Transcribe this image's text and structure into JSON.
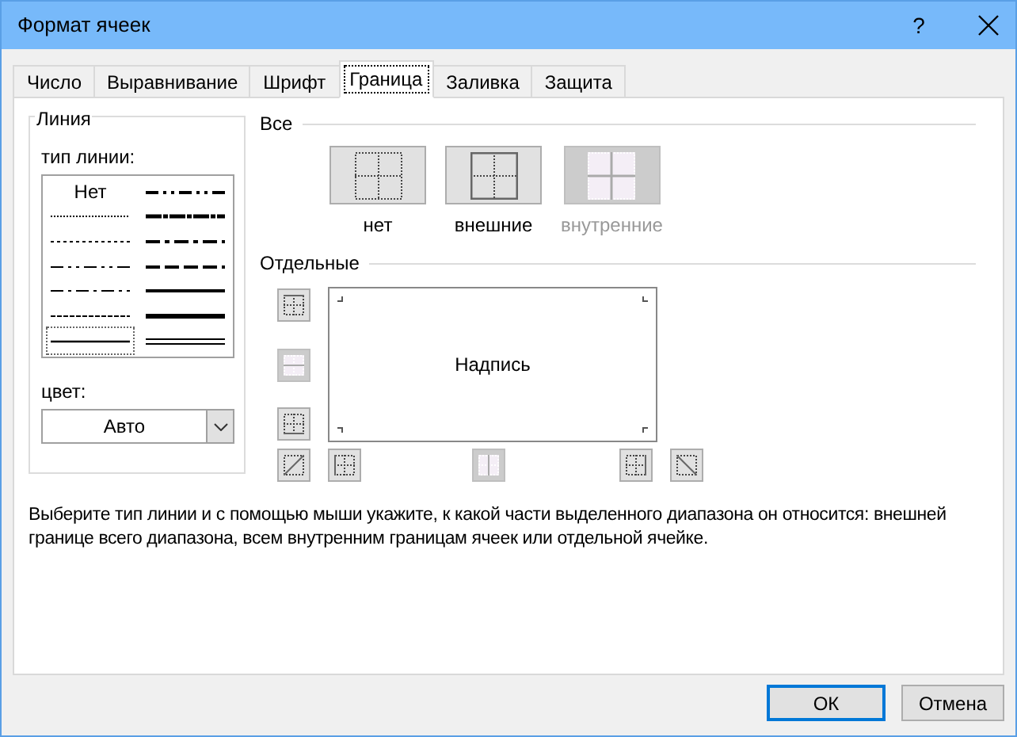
{
  "window": {
    "title": "Формат ячеек",
    "help": "?"
  },
  "tabs": [
    {
      "label": "Число",
      "selected": false
    },
    {
      "label": "Выравнивание",
      "selected": false
    },
    {
      "label": "Шрифт",
      "selected": false
    },
    {
      "label": "Граница",
      "selected": true
    },
    {
      "label": "Заливка",
      "selected": false
    },
    {
      "label": "Защита",
      "selected": false
    }
  ],
  "line_group": {
    "title": "Линия",
    "type_label": "тип линии:",
    "color_label": "цвет:",
    "color_value": "Авто"
  },
  "line_styles": [
    {
      "kind": "none",
      "label": "Нет",
      "selected": false
    },
    {
      "kind": "hair",
      "selected": false
    },
    {
      "kind": "dotted",
      "selected": false
    },
    {
      "kind": "dashdotdot",
      "selected": false
    },
    {
      "kind": "dashdot",
      "selected": false
    },
    {
      "kind": "dashed",
      "selected": false
    },
    {
      "kind": "thin",
      "selected": true
    },
    {
      "kind": "medium-dashdotdot",
      "selected": false
    },
    {
      "kind": "slant-dashdot",
      "selected": false
    },
    {
      "kind": "medium-dashdot",
      "selected": false
    },
    {
      "kind": "medium-dashed",
      "selected": false
    },
    {
      "kind": "medium",
      "selected": false
    },
    {
      "kind": "thick",
      "selected": false
    },
    {
      "kind": "double",
      "selected": false
    }
  ],
  "presets_title": "Все",
  "presets": [
    {
      "kind": "none",
      "label": "нет",
      "disabled": false
    },
    {
      "kind": "outline",
      "label": "внешние",
      "disabled": false
    },
    {
      "kind": "inside",
      "label": "внутренние",
      "disabled": true
    }
  ],
  "borders_title": "Отдельные",
  "preview_text": "Надпись",
  "side_buttons": [
    {
      "kind": "top",
      "disabled": false
    },
    {
      "kind": "inner-horizontal",
      "disabled": true
    },
    {
      "kind": "bottom",
      "disabled": false
    }
  ],
  "bottom_buttons": [
    {
      "kind": "diag-up",
      "disabled": false
    },
    {
      "kind": "left",
      "disabled": false
    },
    {
      "kind": "inner-vertical",
      "disabled": true
    },
    {
      "kind": "right",
      "disabled": false
    },
    {
      "kind": "diag-down",
      "disabled": false
    }
  ],
  "description": "Выберите тип линии и с помощью мыши укажите, к какой части выделенного диапазона он относится: внешней границе всего диапазона, всем внутренним границам ячеек или отдельной ячейке.",
  "buttons": [
    {
      "label": "ОК",
      "default": true
    },
    {
      "label": "Отмена",
      "default": false
    }
  ]
}
